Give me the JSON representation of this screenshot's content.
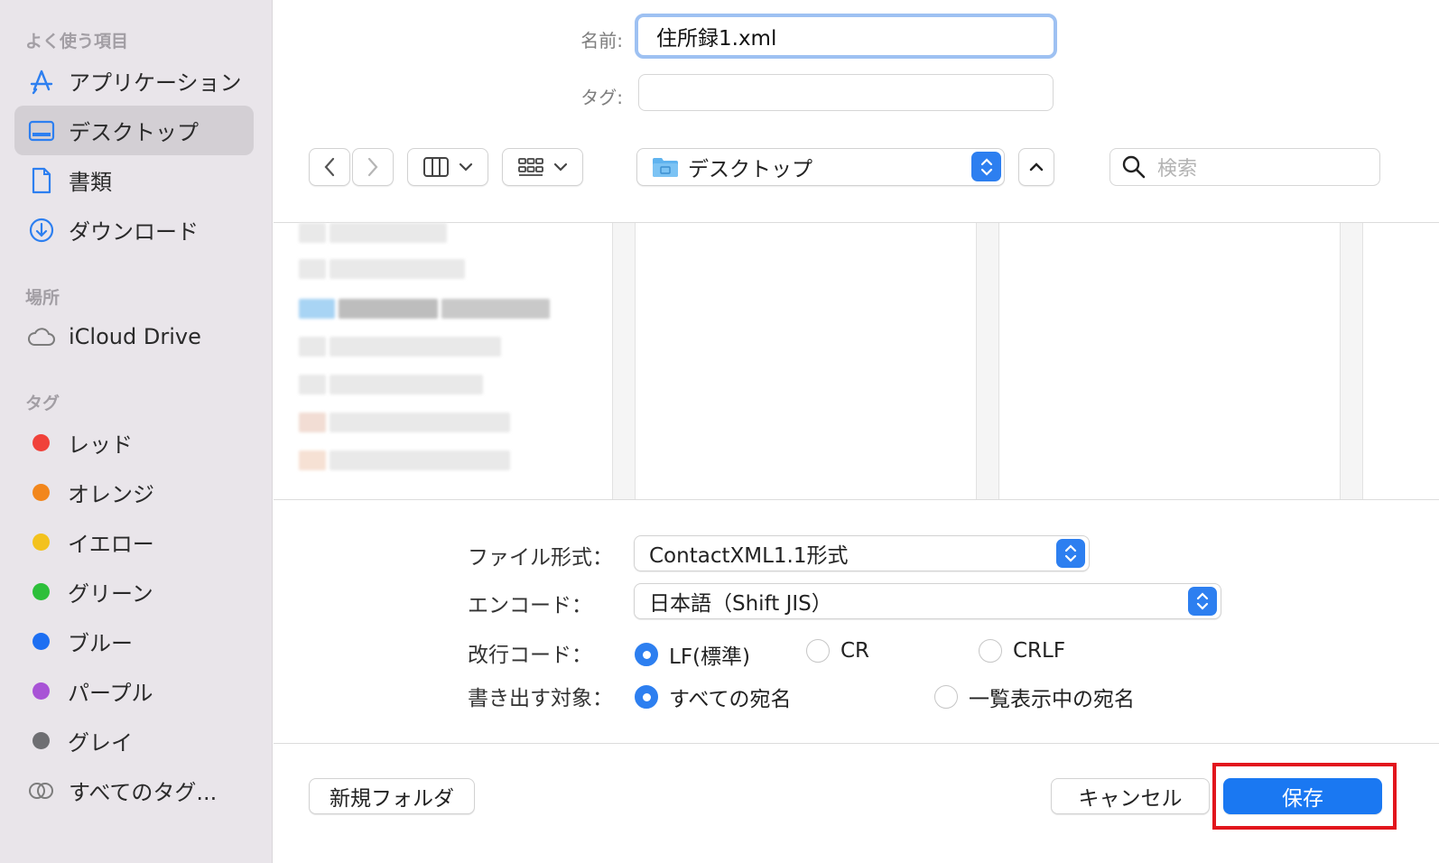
{
  "sidebar": {
    "favorites_heading": "よく使う項目",
    "favorites": [
      {
        "label": "アプリケーション",
        "icon": "app-store-icon"
      },
      {
        "label": "デスクトップ",
        "icon": "desktop-icon",
        "selected": true
      },
      {
        "label": "書類",
        "icon": "document-icon"
      },
      {
        "label": "ダウンロード",
        "icon": "download-icon"
      }
    ],
    "locations_heading": "場所",
    "locations": [
      {
        "label": "iCloud Drive",
        "icon": "cloud-icon"
      }
    ],
    "tags_heading": "タグ",
    "tags": [
      {
        "label": "レッド",
        "color": "#f0413a"
      },
      {
        "label": "オレンジ",
        "color": "#f2861b"
      },
      {
        "label": "イエロー",
        "color": "#f3c21d"
      },
      {
        "label": "グリーン",
        "color": "#2dbf3a"
      },
      {
        "label": "ブルー",
        "color": "#1d6ff2"
      },
      {
        "label": "パープル",
        "color": "#a853d6"
      },
      {
        "label": "グレイ",
        "color": "#6e6e72"
      }
    ],
    "all_tags": "すべてのタグ..."
  },
  "form": {
    "name_label": "名前:",
    "name_value": "住所録1.xml",
    "tag_label": "タグ:",
    "tag_value": ""
  },
  "toolbar": {
    "location": "デスクトップ",
    "search_placeholder": "検索"
  },
  "options": {
    "format_label": "ファイル形式：",
    "format_value": "ContactXML1.1形式",
    "encoding_label": "エンコード：",
    "encoding_value": "日本語（Shift JIS）",
    "newline_label": "改行コード：",
    "newline_options": [
      "LF(標準)",
      "CR",
      "CRLF"
    ],
    "newline_selected": "LF(標準)",
    "target_label": "書き出す対象：",
    "target_options": [
      "すべての宛名",
      "一覧表示中の宛名"
    ],
    "target_selected": "すべての宛名"
  },
  "buttons": {
    "new_folder": "新規フォルダ",
    "cancel": "キャンセル",
    "save": "保存"
  },
  "colors": {
    "accent": "#1a78f2",
    "highlight_box": "#e2161d"
  }
}
